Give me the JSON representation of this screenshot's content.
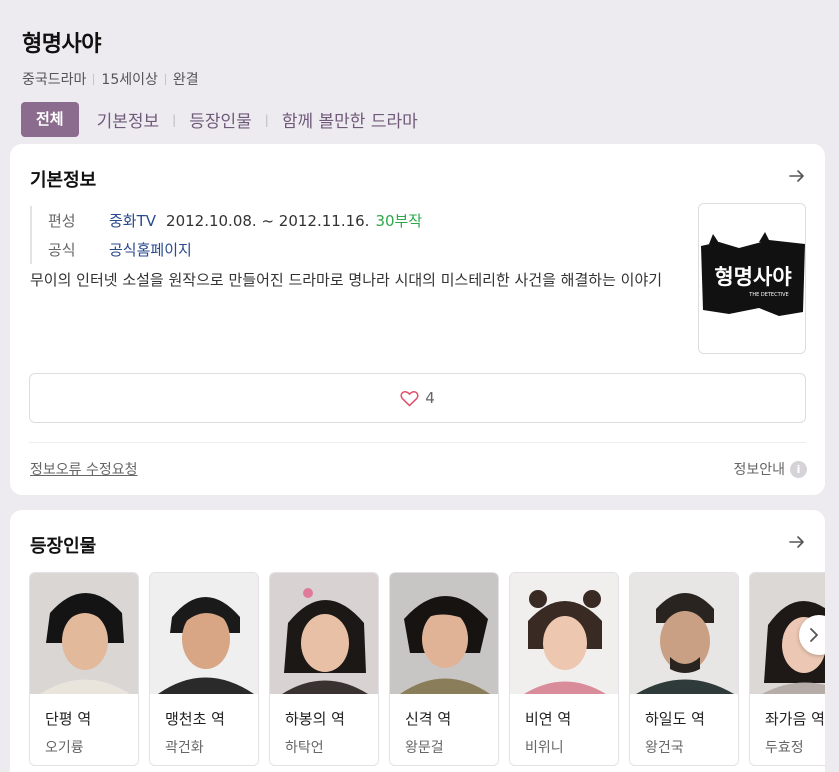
{
  "header": {
    "title": "형명사야",
    "meta": [
      "중국드라마",
      "15세이상",
      "완결"
    ],
    "tabs": [
      "전체",
      "기본정보",
      "등장인물",
      "함께 볼만한 드라마"
    ]
  },
  "basic": {
    "title": "기본정보",
    "broadcast_label": "편성",
    "channel": "중화TV",
    "period": "2012.10.08. ~ 2012.11.16.",
    "episodes": "30부작",
    "official_label": "공식",
    "official_link": "공식홈페이지",
    "description": "무이의 인터넷 소설을 원작으로 만들어진 드라마로 명나라 시대의 미스테리한 사건을 해결하는 이야기",
    "poster_text": "형명사야",
    "poster_subtext": "THE DETECTIVE",
    "likes": "4",
    "report_link": "정보오류 수정요청",
    "guide_label": "정보안내",
    "guide_icon": "i"
  },
  "cast": {
    "title": "등장인물",
    "members": [
      {
        "role": "단평 역",
        "actor": "오기륭"
      },
      {
        "role": "맹천초 역",
        "actor": "곽건화"
      },
      {
        "role": "하봉의 역",
        "actor": "하탁언"
      },
      {
        "role": "신격 역",
        "actor": "왕문걸"
      },
      {
        "role": "비연 역",
        "actor": "비위니"
      },
      {
        "role": "하일도 역",
        "actor": "왕건국"
      },
      {
        "role": "좌가음 역",
        "actor": "두효정"
      }
    ]
  },
  "colors": {
    "accent": "#8c6c8e",
    "link": "#2a4a8e",
    "green": "#2ea84a",
    "background": "#eeebf0"
  }
}
